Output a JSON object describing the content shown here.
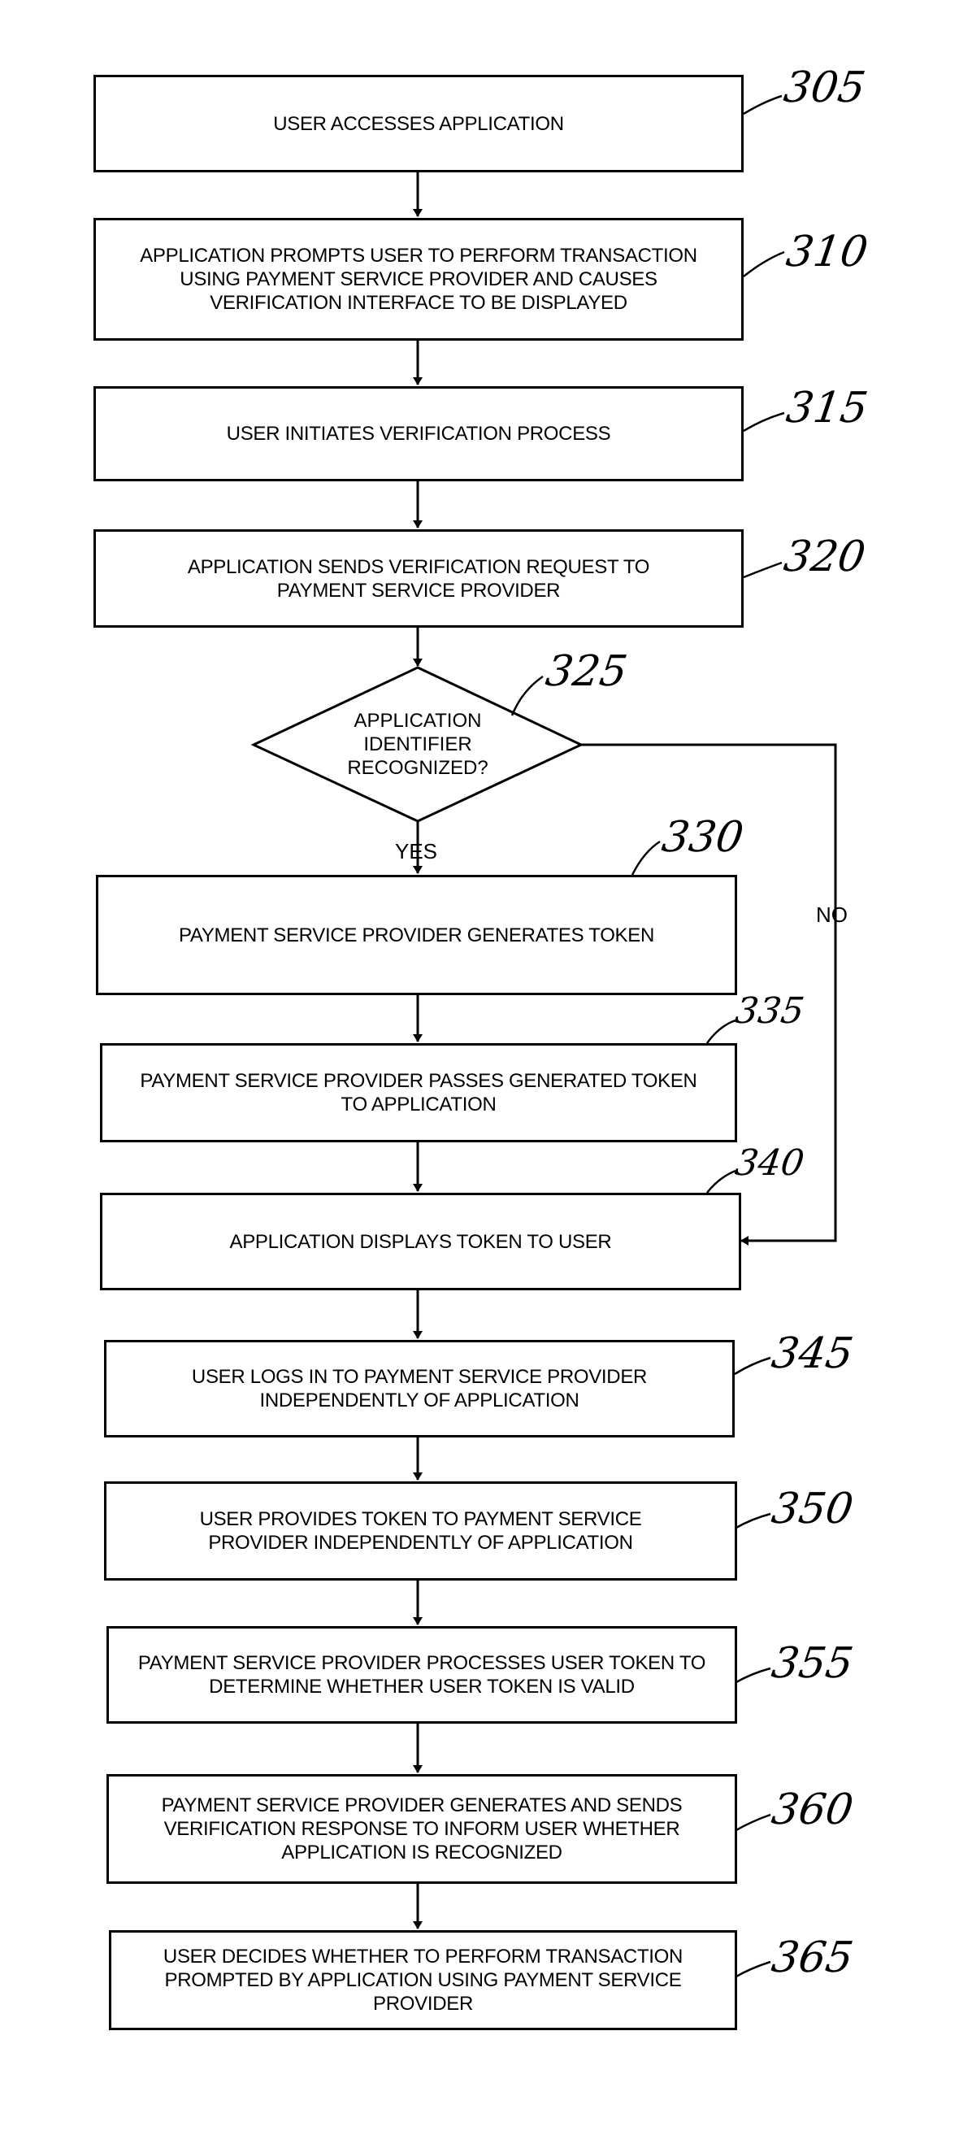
{
  "flowchart": {
    "steps": [
      {
        "ref": "305",
        "text": "USER ACCESSES APPLICATION"
      },
      {
        "ref": "310",
        "text": "APPLICATION PROMPTS USER TO PERFORM TRANSACTION USING PAYMENT SERVICE PROVIDER AND CAUSES VERIFICATION INTERFACE TO BE DISPLAYED"
      },
      {
        "ref": "315",
        "text": "USER INITIATES VERIFICATION PROCESS"
      },
      {
        "ref": "320",
        "text": "APPLICATION SENDS VERIFICATION REQUEST TO PAYMENT SERVICE PROVIDER"
      },
      {
        "ref": "330",
        "text": "PAYMENT SERVICE PROVIDER GENERATES TOKEN"
      },
      {
        "ref": "335",
        "text": "PAYMENT SERVICE PROVIDER PASSES GENERATED TOKEN TO APPLICATION"
      },
      {
        "ref": "340",
        "text": "APPLICATION DISPLAYS TOKEN TO USER"
      },
      {
        "ref": "345",
        "text": "USER LOGS IN TO PAYMENT SERVICE PROVIDER INDEPENDENTLY OF APPLICATION"
      },
      {
        "ref": "350",
        "text": "USER PROVIDES TOKEN TO PAYMENT SERVICE PROVIDER INDEPENDENTLY OF APPLICATION"
      },
      {
        "ref": "355",
        "text": "PAYMENT SERVICE PROVIDER PROCESSES USER TOKEN TO DETERMINE WHETHER USER TOKEN IS VALID"
      },
      {
        "ref": "360",
        "text": "PAYMENT SERVICE PROVIDER GENERATES AND SENDS VERIFICATION RESPONSE TO INFORM USER WHETHER APPLICATION IS RECOGNIZED"
      },
      {
        "ref": "365",
        "text": "USER DECIDES WHETHER TO PERFORM TRANSACTION PROMPTED BY APPLICATION USING PAYMENT SERVICE PROVIDER"
      }
    ],
    "decision": {
      "ref": "325",
      "lines": [
        "APPLICATION",
        "IDENTIFIER",
        "RECOGNIZED?"
      ],
      "yes_label": "YES",
      "no_label": "NO"
    }
  }
}
